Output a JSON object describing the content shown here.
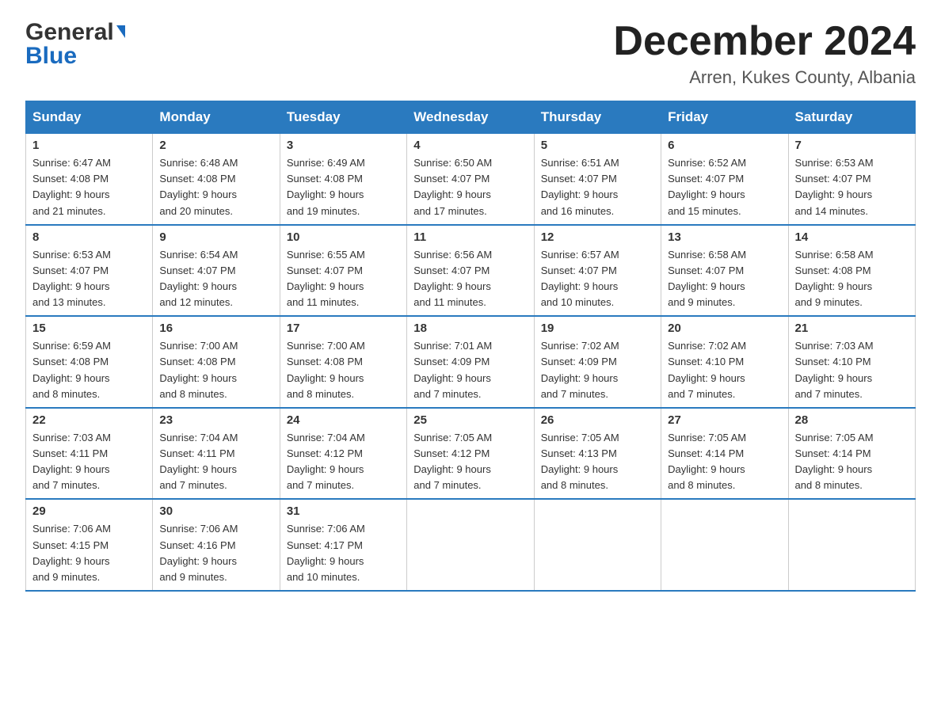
{
  "header": {
    "logo_general": "General",
    "logo_blue": "Blue",
    "month_title": "December 2024",
    "location": "Arren, Kukes County, Albania"
  },
  "days_of_week": [
    "Sunday",
    "Monday",
    "Tuesday",
    "Wednesday",
    "Thursday",
    "Friday",
    "Saturday"
  ],
  "weeks": [
    [
      {
        "day": "1",
        "sunrise": "6:47 AM",
        "sunset": "4:08 PM",
        "daylight": "9 hours and 21 minutes."
      },
      {
        "day": "2",
        "sunrise": "6:48 AM",
        "sunset": "4:08 PM",
        "daylight": "9 hours and 20 minutes."
      },
      {
        "day": "3",
        "sunrise": "6:49 AM",
        "sunset": "4:08 PM",
        "daylight": "9 hours and 19 minutes."
      },
      {
        "day": "4",
        "sunrise": "6:50 AM",
        "sunset": "4:07 PM",
        "daylight": "9 hours and 17 minutes."
      },
      {
        "day": "5",
        "sunrise": "6:51 AM",
        "sunset": "4:07 PM",
        "daylight": "9 hours and 16 minutes."
      },
      {
        "day": "6",
        "sunrise": "6:52 AM",
        "sunset": "4:07 PM",
        "daylight": "9 hours and 15 minutes."
      },
      {
        "day": "7",
        "sunrise": "6:53 AM",
        "sunset": "4:07 PM",
        "daylight": "9 hours and 14 minutes."
      }
    ],
    [
      {
        "day": "8",
        "sunrise": "6:53 AM",
        "sunset": "4:07 PM",
        "daylight": "9 hours and 13 minutes."
      },
      {
        "day": "9",
        "sunrise": "6:54 AM",
        "sunset": "4:07 PM",
        "daylight": "9 hours and 12 minutes."
      },
      {
        "day": "10",
        "sunrise": "6:55 AM",
        "sunset": "4:07 PM",
        "daylight": "9 hours and 11 minutes."
      },
      {
        "day": "11",
        "sunrise": "6:56 AM",
        "sunset": "4:07 PM",
        "daylight": "9 hours and 11 minutes."
      },
      {
        "day": "12",
        "sunrise": "6:57 AM",
        "sunset": "4:07 PM",
        "daylight": "9 hours and 10 minutes."
      },
      {
        "day": "13",
        "sunrise": "6:58 AM",
        "sunset": "4:07 PM",
        "daylight": "9 hours and 9 minutes."
      },
      {
        "day": "14",
        "sunrise": "6:58 AM",
        "sunset": "4:08 PM",
        "daylight": "9 hours and 9 minutes."
      }
    ],
    [
      {
        "day": "15",
        "sunrise": "6:59 AM",
        "sunset": "4:08 PM",
        "daylight": "9 hours and 8 minutes."
      },
      {
        "day": "16",
        "sunrise": "7:00 AM",
        "sunset": "4:08 PM",
        "daylight": "9 hours and 8 minutes."
      },
      {
        "day": "17",
        "sunrise": "7:00 AM",
        "sunset": "4:08 PM",
        "daylight": "9 hours and 8 minutes."
      },
      {
        "day": "18",
        "sunrise": "7:01 AM",
        "sunset": "4:09 PM",
        "daylight": "9 hours and 7 minutes."
      },
      {
        "day": "19",
        "sunrise": "7:02 AM",
        "sunset": "4:09 PM",
        "daylight": "9 hours and 7 minutes."
      },
      {
        "day": "20",
        "sunrise": "7:02 AM",
        "sunset": "4:10 PM",
        "daylight": "9 hours and 7 minutes."
      },
      {
        "day": "21",
        "sunrise": "7:03 AM",
        "sunset": "4:10 PM",
        "daylight": "9 hours and 7 minutes."
      }
    ],
    [
      {
        "day": "22",
        "sunrise": "7:03 AM",
        "sunset": "4:11 PM",
        "daylight": "9 hours and 7 minutes."
      },
      {
        "day": "23",
        "sunrise": "7:04 AM",
        "sunset": "4:11 PM",
        "daylight": "9 hours and 7 minutes."
      },
      {
        "day": "24",
        "sunrise": "7:04 AM",
        "sunset": "4:12 PM",
        "daylight": "9 hours and 7 minutes."
      },
      {
        "day": "25",
        "sunrise": "7:05 AM",
        "sunset": "4:12 PM",
        "daylight": "9 hours and 7 minutes."
      },
      {
        "day": "26",
        "sunrise": "7:05 AM",
        "sunset": "4:13 PM",
        "daylight": "9 hours and 8 minutes."
      },
      {
        "day": "27",
        "sunrise": "7:05 AM",
        "sunset": "4:14 PM",
        "daylight": "9 hours and 8 minutes."
      },
      {
        "day": "28",
        "sunrise": "7:05 AM",
        "sunset": "4:14 PM",
        "daylight": "9 hours and 8 minutes."
      }
    ],
    [
      {
        "day": "29",
        "sunrise": "7:06 AM",
        "sunset": "4:15 PM",
        "daylight": "9 hours and 9 minutes."
      },
      {
        "day": "30",
        "sunrise": "7:06 AM",
        "sunset": "4:16 PM",
        "daylight": "9 hours and 9 minutes."
      },
      {
        "day": "31",
        "sunrise": "7:06 AM",
        "sunset": "4:17 PM",
        "daylight": "9 hours and 10 minutes."
      },
      null,
      null,
      null,
      null
    ]
  ],
  "labels": {
    "sunrise": "Sunrise:",
    "sunset": "Sunset:",
    "daylight": "Daylight:"
  }
}
